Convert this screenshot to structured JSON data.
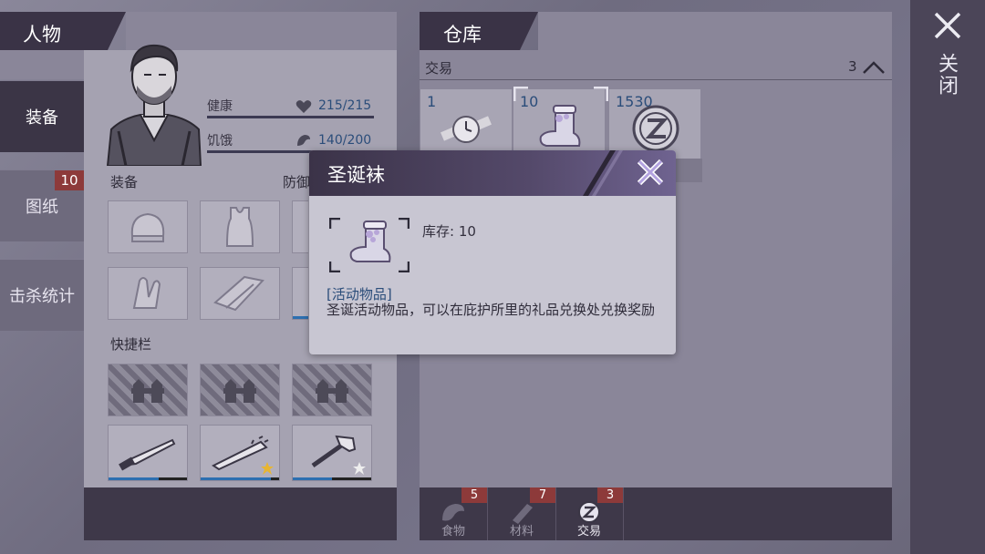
{
  "character": {
    "header": "人物",
    "stats": [
      {
        "label": "健康",
        "value": "215/215",
        "icon": "heart-icon",
        "fill": 1.0
      },
      {
        "label": "饥饿",
        "value": "140/200",
        "icon": "food-icon",
        "fill": 0.7
      }
    ],
    "equipment_label": "装备",
    "defense_label": "防御",
    "quickbar_label": "快捷栏"
  },
  "nav": {
    "tabs": [
      {
        "label": "装备",
        "active": true
      },
      {
        "label": "图纸",
        "badge": "10"
      },
      {
        "label": "击杀统计"
      }
    ]
  },
  "warehouse": {
    "header": "仓库",
    "subheader": "交易",
    "count": "3",
    "items": [
      {
        "qty": "1",
        "icon": "watch-icon"
      },
      {
        "qty": "10",
        "icon": "christmas-sock-icon",
        "selected": true
      },
      {
        "qty": "1530",
        "icon": "coin-icon"
      }
    ],
    "categories": [
      {
        "label": "食物",
        "badge": "5",
        "icon": "food-icon"
      },
      {
        "label": "材料",
        "badge": "7",
        "icon": "material-icon"
      },
      {
        "label": "交易",
        "badge": "3",
        "icon": "coin-icon",
        "active": true
      }
    ]
  },
  "close": {
    "label": "关闭"
  },
  "popup": {
    "title": "圣诞袜",
    "stock": "库存: 10",
    "category": "[活动物品]",
    "description": "圣诞活动物品，可以在庇护所里的礼品兑换处兑换奖励"
  },
  "colors": {
    "accent_blue": "#2b4d7a",
    "badge_red": "#8d3a3a",
    "header_dark": "#3a3346"
  }
}
